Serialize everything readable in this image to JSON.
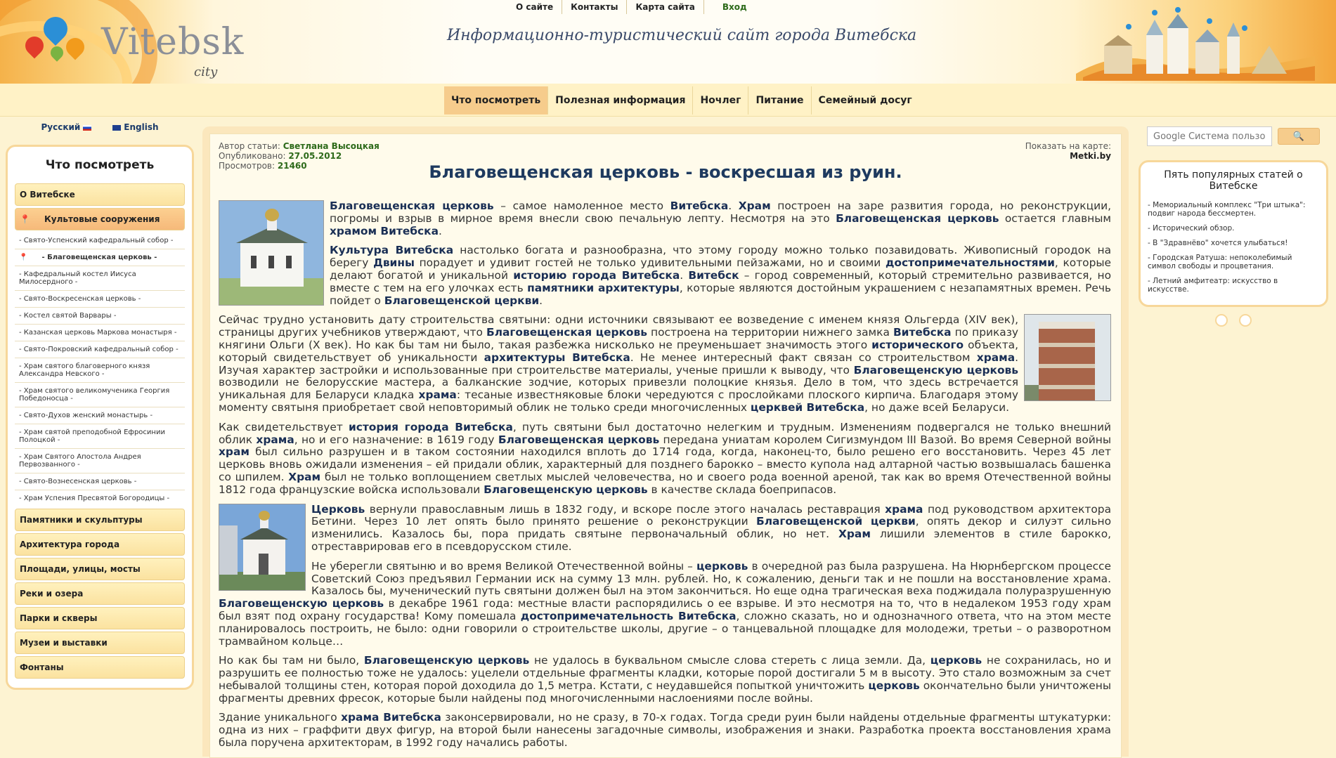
{
  "header": {
    "logo": {
      "word": "Vitebsk",
      "sub": "city"
    },
    "top_menu": [
      "О сайте",
      "Контакты",
      "Карта сайта",
      "Вход"
    ],
    "tagline": "Информационно-туристический  сайт города Витебска"
  },
  "main_nav": [
    "Что посмотреть",
    "Полезная информация",
    "Ночлег",
    "Питание",
    "Семейный досуг"
  ],
  "languages": [
    "Русский",
    "English"
  ],
  "sidebar": {
    "title": "Что посмотреть",
    "cat_about": "О Витебске",
    "cat_active": "Культовые сооружения",
    "subitems": [
      "- Свято-Успенский кафедральный собор -",
      "- Благовещенская церковь -",
      "- Кафедральный костел Иисуса Милосердного -",
      "- Свято-Воскресенская церковь -",
      "- Костел святой Варвары -",
      "- Казанская церковь Маркова монастыря -",
      "- Свято-Покровский кафедральный собор -",
      "- Храм святого благоверного князя Александра Невского -",
      "- Храм святого великомученика Георгия Победоносца -",
      "- Свято-Духов женский монастырь -",
      "- Храм святой преподобной Ефросинии Полоцкой -",
      "- Храм Святого Апостола Андрея Первозванного -",
      "- Свято-Вознесенская церковь -",
      "- Храм Успения Пресвятой Богородицы -"
    ],
    "categories": [
      "Памятники и скульптуры",
      "Архитектура города",
      "Площади, улицы, мосты",
      "Реки и озера",
      "Парки и скверы",
      "Музеи и выставки",
      "Фонтаны"
    ]
  },
  "article": {
    "author_label": "Автор статьи:",
    "author": "Светлана Высоцкая",
    "published_label": "Опубликовано:",
    "published": "27.05.2012",
    "views_label": "Просмотров:",
    "views": "21460",
    "map_label": "Показать на карте:",
    "map_link": "Metki.by",
    "title": "Благовещенская церковь - воскресшая из руин."
  },
  "search": {
    "placeholder": "Google Система пользо",
    "button": "🔍"
  },
  "popular": {
    "title": "Пять популярных статей о Витебске",
    "items": [
      "- Мемориальный комплекс \"Три штыка\": подвиг народа бессмертен.",
      "- Исторический обзор.",
      "- В \"Здравнёво\" хочется улыбаться!",
      "- Городская Ратуша: непоколебимый символ свободы и процветания.",
      "- Летний амфитеатр: искусство в искусстве."
    ]
  },
  "colors": {
    "accent": "#f6cc8c",
    "panel_border": "#f7d79a",
    "title": "#1e3a5f"
  }
}
